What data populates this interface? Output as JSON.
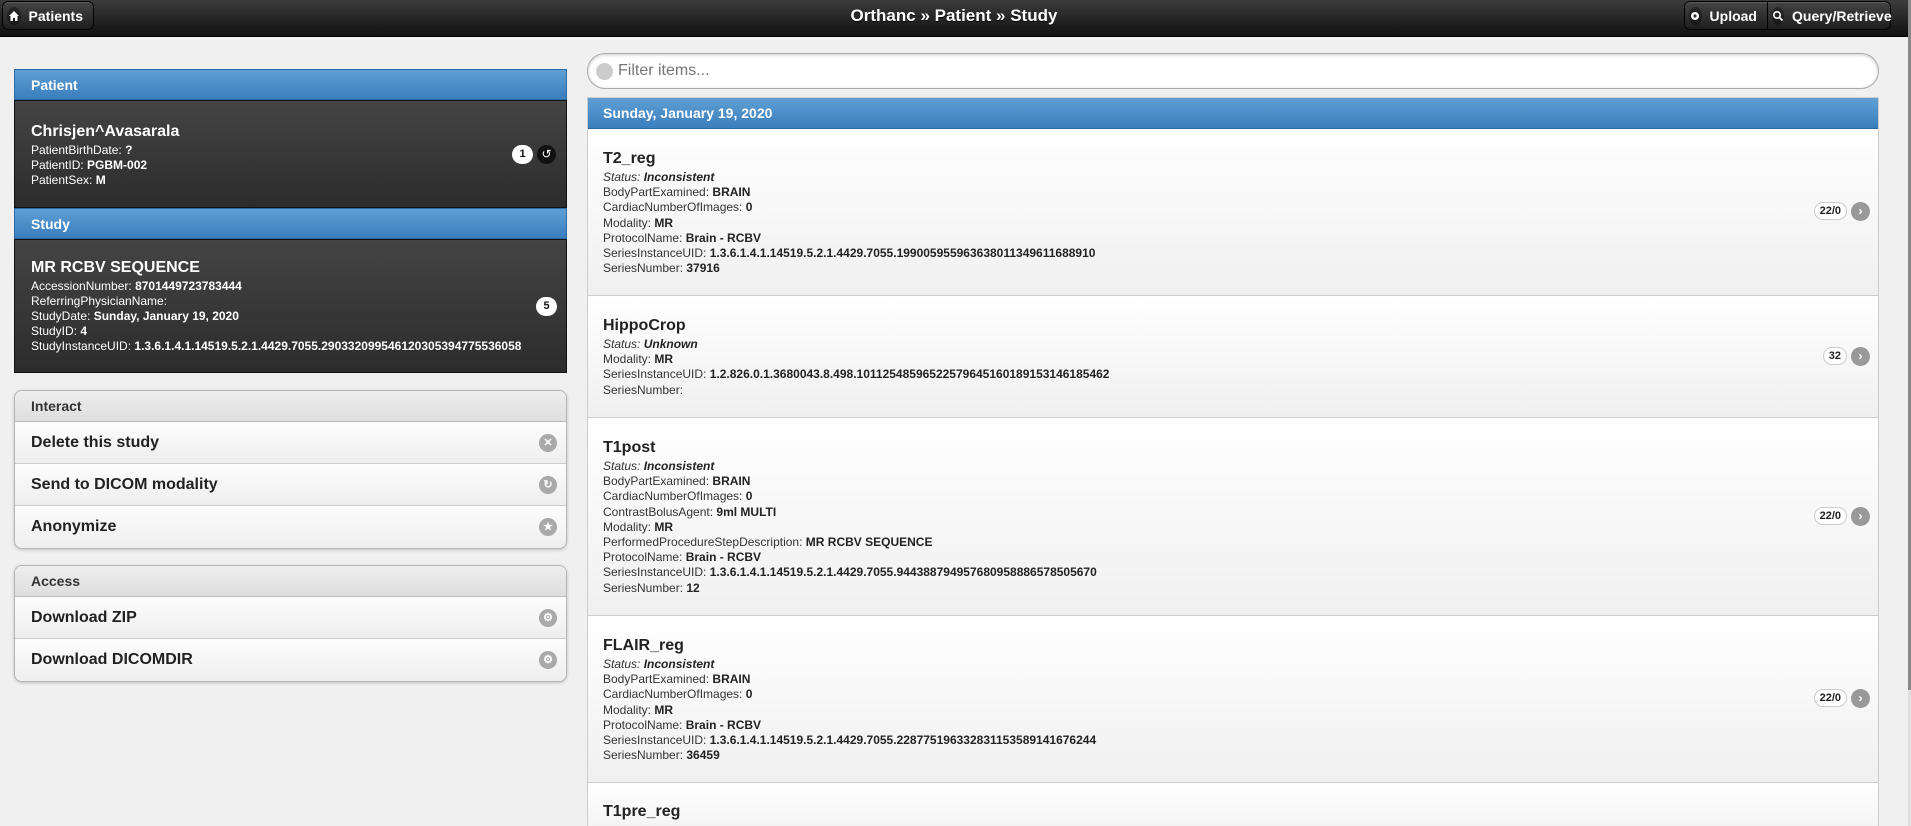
{
  "header": {
    "patients_label": "Patients",
    "title": "Orthanc » Patient » Study",
    "upload_label": "Upload",
    "query_label": "Query/Retrieve"
  },
  "patient": {
    "heading": "Patient",
    "name": "Chrisjen^Avasarala",
    "fields": [
      {
        "label": "PatientBirthDate:",
        "value": "?"
      },
      {
        "label": "PatientID:",
        "value": "PGBM-002"
      },
      {
        "label": "PatientSex:",
        "value": "M"
      }
    ],
    "count": "1"
  },
  "study": {
    "heading": "Study",
    "name": "MR RCBV SEQUENCE",
    "fields": [
      {
        "label": "AccessionNumber:",
        "value": "8701449723783444"
      },
      {
        "label": "ReferringPhysicianName:",
        "value": ""
      },
      {
        "label": "StudyDate:",
        "value": "Sunday, January 19, 2020"
      },
      {
        "label": "StudyID:",
        "value": "4"
      },
      {
        "label": "StudyInstanceUID:",
        "value": "1.3.6.1.4.1.14519.5.2.1.4429.7055.290332099546120305394775536058"
      }
    ],
    "count": "5"
  },
  "interact": {
    "heading": "Interact",
    "items": [
      {
        "label": "Delete this study",
        "icon": "delete-icon"
      },
      {
        "label": "Send to DICOM modality",
        "icon": "send-icon"
      },
      {
        "label": "Anonymize",
        "icon": "star-icon"
      }
    ]
  },
  "access": {
    "heading": "Access",
    "items": [
      {
        "label": "Download ZIP",
        "icon": "gear-icon"
      },
      {
        "label": "Download DICOMDIR",
        "icon": "gear-icon"
      }
    ]
  },
  "filter": {
    "placeholder": "Filter items..."
  },
  "series_date": "Sunday, January 19, 2020",
  "series": [
    {
      "name": "T2_reg",
      "status_label": "Status:",
      "status": "Inconsistent",
      "count": "22/0",
      "fields": [
        {
          "label": "BodyPartExamined:",
          "value": "BRAIN"
        },
        {
          "label": "CardiacNumberOfImages:",
          "value": "0"
        },
        {
          "label": "Modality:",
          "value": "MR"
        },
        {
          "label": "ProtocolName:",
          "value": "Brain - RCBV"
        },
        {
          "label": "SeriesInstanceUID:",
          "value": "1.3.6.1.4.1.14519.5.2.1.4429.7055.199005955963638011349611688910"
        },
        {
          "label": "SeriesNumber:",
          "value": "37916"
        }
      ]
    },
    {
      "name": "HippoCrop",
      "status_label": "Status:",
      "status": "Unknown",
      "count": "32",
      "fields": [
        {
          "label": "Modality:",
          "value": "MR"
        },
        {
          "label": "SeriesInstanceUID:",
          "value": "1.2.826.0.1.3680043.8.498.10112548596522579645160189153146185462"
        },
        {
          "label": "SeriesNumber:",
          "value": ""
        }
      ]
    },
    {
      "name": "T1post",
      "status_label": "Status:",
      "status": "Inconsistent",
      "count": "22/0",
      "fields": [
        {
          "label": "BodyPartExamined:",
          "value": "BRAIN"
        },
        {
          "label": "CardiacNumberOfImages:",
          "value": "0"
        },
        {
          "label": "ContrastBolusAgent:",
          "value": "9ml MULTI"
        },
        {
          "label": "Modality:",
          "value": "MR"
        },
        {
          "label": "PerformedProcedureStepDescription:",
          "value": "MR RCBV SEQUENCE"
        },
        {
          "label": "ProtocolName:",
          "value": "Brain - RCBV"
        },
        {
          "label": "SeriesInstanceUID:",
          "value": "1.3.6.1.4.1.14519.5.2.1.4429.7055.944388794957680958886578505670"
        },
        {
          "label": "SeriesNumber:",
          "value": "12"
        }
      ]
    },
    {
      "name": "FLAIR_reg",
      "status_label": "Status:",
      "status": "Inconsistent",
      "count": "22/0",
      "fields": [
        {
          "label": "BodyPartExamined:",
          "value": "BRAIN"
        },
        {
          "label": "CardiacNumberOfImages:",
          "value": "0"
        },
        {
          "label": "Modality:",
          "value": "MR"
        },
        {
          "label": "ProtocolName:",
          "value": "Brain - RCBV"
        },
        {
          "label": "SeriesInstanceUID:",
          "value": "1.3.6.1.4.1.14519.5.2.1.4429.7055.228775196332831153589141676244"
        },
        {
          "label": "SeriesNumber:",
          "value": "36459"
        }
      ]
    },
    {
      "name": "T1pre_reg",
      "status_label": "",
      "status": "",
      "count": "",
      "fields": []
    }
  ]
}
